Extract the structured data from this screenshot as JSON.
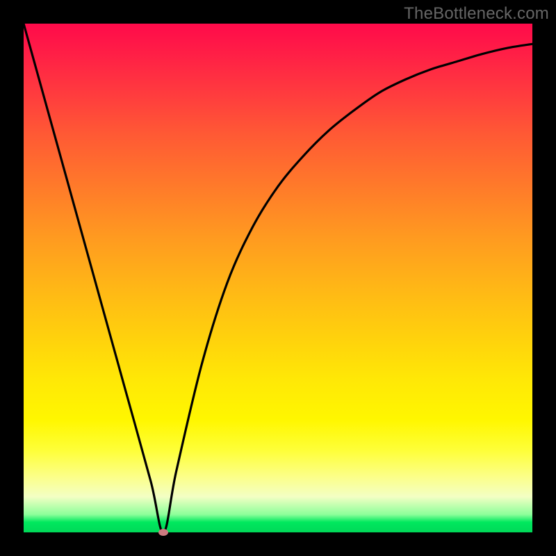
{
  "watermark": "TheBottleneck.com",
  "colors": {
    "background": "#000000",
    "curve": "#000000",
    "marker": "#cc7a7f"
  },
  "chart_data": {
    "type": "line",
    "title": "",
    "xlabel": "",
    "ylabel": "",
    "xlim": [
      0,
      100
    ],
    "ylim": [
      0,
      100
    ],
    "grid": false,
    "series": [
      {
        "name": "bottleneck-curve",
        "x": [
          0,
          5,
          10,
          15,
          20,
          25,
          27.5,
          30,
          35,
          40,
          45,
          50,
          55,
          60,
          65,
          70,
          75,
          80,
          85,
          90,
          95,
          100
        ],
        "values": [
          100,
          82,
          64,
          46,
          28,
          10,
          0,
          12,
          33,
          49,
          60,
          68,
          74,
          79,
          83,
          86.5,
          89,
          91,
          92.5,
          94,
          95.2,
          96
        ]
      }
    ],
    "annotations": [
      {
        "name": "minimum-marker",
        "x": 27.5,
        "y": 0
      }
    ]
  }
}
